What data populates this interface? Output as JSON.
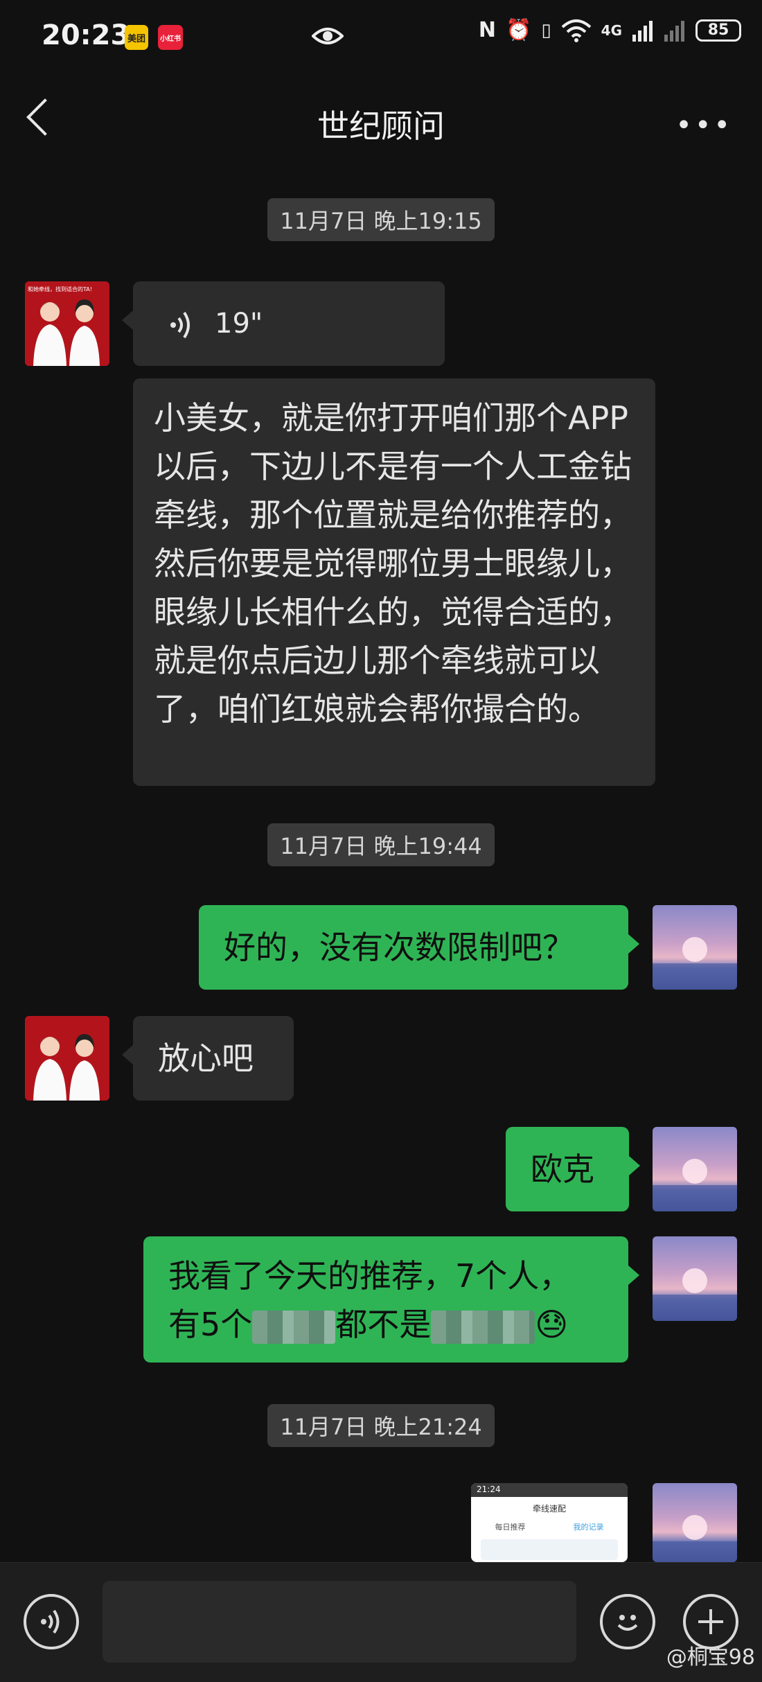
{
  "status_bar": {
    "time": "20:23",
    "app_badges": [
      "美团",
      "小红书"
    ],
    "network": "4G",
    "battery": "85"
  },
  "header": {
    "title": "世纪顾问",
    "back_icon": "chevron-left-icon",
    "more_icon": "more-dots-icon"
  },
  "messages": {
    "ts1": "11月7日 晚上19:15",
    "voice_duration": "19\"",
    "long_text": "小美女，就是你打开咱们那个APP以后，下边儿不是有一个人工金钻牵线，那个位置就是给你推荐的，然后你要是觉得哪位男士眼缘儿，眼缘儿长相什么的，觉得合适的，就是你点后边儿那个牵线就可以了，咱们红娘就会帮你撮合的。",
    "ts2": "11月7日 晚上19:44",
    "reply1": "好的，没有次数限制吧？",
    "reply2": "放心吧",
    "reply3": "欧克",
    "reply4_line1": "我看了今天的推荐，7个人，",
    "reply4_line2a": "有5个",
    "reply4_line2b": "都不是",
    "ts3": "11月7日 晚上21:24"
  },
  "avatar_left_caption": "和她牵线，找到适合的TA!",
  "screenshot_thumb": {
    "time": "21:24",
    "title": "牵线速配",
    "tab1": "每日推荐",
    "tab2": "我的记录"
  },
  "watermark": "@桐宝98"
}
